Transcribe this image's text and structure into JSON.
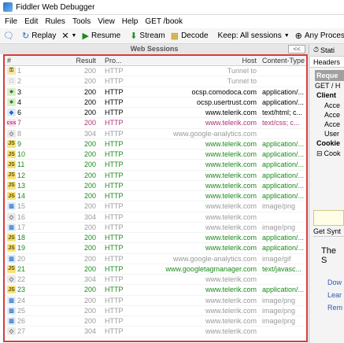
{
  "window": {
    "title": "Fiddler Web Debugger"
  },
  "menu": [
    "File",
    "Edit",
    "Rules",
    "Tools",
    "View",
    "Help",
    "GET /book"
  ],
  "toolbar": {
    "replay": "Replay",
    "resume": "Resume",
    "stream": "Stream",
    "decode": "Decode",
    "keep": "Keep: All sessions",
    "process": "Any Process"
  },
  "web_sessions": {
    "title": "Web Sessions",
    "collapse": "<<"
  },
  "columns": {
    "num": "#",
    "result": "Result",
    "protocol": "Pro...",
    "host": "Host",
    "content_type": "Content-Type"
  },
  "colors": {
    "green": "#1a8a1a",
    "gray": "#9a9a9a",
    "magenta": "#b0307a",
    "highlight": "#d63c3c"
  },
  "sessions": [
    {
      "num": "1",
      "result": "200",
      "protocol": "HTTP",
      "host": "Tunnel to",
      "content_type": "",
      "icon": "lock-icon",
      "color": "gray"
    },
    {
      "num": "2",
      "result": "200",
      "protocol": "HTTP",
      "host": "Tunnel to",
      "content_type": "",
      "icon": "doc-icon",
      "color": "gray"
    },
    {
      "num": "3",
      "result": "200",
      "protocol": "HTTP",
      "host": "ocsp.comodoca.com",
      "content_type": "application/...",
      "icon": "cert-icon",
      "color": "black"
    },
    {
      "num": "4",
      "result": "200",
      "protocol": "HTTP",
      "host": "ocsp.usertrust.com",
      "content_type": "application/...",
      "icon": "cert-icon",
      "color": "black"
    },
    {
      "num": "6",
      "result": "200",
      "protocol": "HTTP",
      "host": "www.telerik.com",
      "content_type": "text/html; c...",
      "icon": "html-icon",
      "color": "black"
    },
    {
      "num": "7",
      "result": "200",
      "protocol": "HTTP",
      "host": "www.telerik.com",
      "content_type": "text/css; c...",
      "icon": "css-icon",
      "color": "magenta"
    },
    {
      "num": "8",
      "result": "304",
      "protocol": "HTTP",
      "host": "www.google-analytics.com",
      "content_type": "",
      "icon": "cache-icon",
      "color": "gray"
    },
    {
      "num": "9",
      "result": "200",
      "protocol": "HTTP",
      "host": "www.telerik.com",
      "content_type": "application/...",
      "icon": "js-icon",
      "color": "green"
    },
    {
      "num": "10",
      "result": "200",
      "protocol": "HTTP",
      "host": "www.telerik.com",
      "content_type": "application/...",
      "icon": "js-icon",
      "color": "green"
    },
    {
      "num": "11",
      "result": "200",
      "protocol": "HTTP",
      "host": "www.telerik.com",
      "content_type": "application/...",
      "icon": "js-icon",
      "color": "green"
    },
    {
      "num": "12",
      "result": "200",
      "protocol": "HTTP",
      "host": "www.telerik.com",
      "content_type": "application/...",
      "icon": "js-icon",
      "color": "green"
    },
    {
      "num": "13",
      "result": "200",
      "protocol": "HTTP",
      "host": "www.telerik.com",
      "content_type": "application/...",
      "icon": "js-icon",
      "color": "green"
    },
    {
      "num": "14",
      "result": "200",
      "protocol": "HTTP",
      "host": "www.telerik.com",
      "content_type": "application/...",
      "icon": "js-icon",
      "color": "green"
    },
    {
      "num": "15",
      "result": "200",
      "protocol": "HTTP",
      "host": "www.telerik.com",
      "content_type": "image/png",
      "icon": "image-icon",
      "color": "gray"
    },
    {
      "num": "16",
      "result": "304",
      "protocol": "HTTP",
      "host": "www.telerik.com",
      "content_type": "",
      "icon": "cache-icon",
      "color": "gray"
    },
    {
      "num": "17",
      "result": "200",
      "protocol": "HTTP",
      "host": "www.telerik.com",
      "content_type": "image/png",
      "icon": "image-icon",
      "color": "gray"
    },
    {
      "num": "18",
      "result": "200",
      "protocol": "HTTP",
      "host": "www.telerik.com",
      "content_type": "application/...",
      "icon": "js-icon",
      "color": "green"
    },
    {
      "num": "19",
      "result": "200",
      "protocol": "HTTP",
      "host": "www.telerik.com",
      "content_type": "application/...",
      "icon": "js-icon",
      "color": "green"
    },
    {
      "num": "20",
      "result": "200",
      "protocol": "HTTP",
      "host": "www.google-analytics.com",
      "content_type": "image/gif",
      "icon": "image-icon",
      "color": "gray"
    },
    {
      "num": "21",
      "result": "200",
      "protocol": "HTTP",
      "host": "www.googletagmanager.com",
      "content_type": "text/javasc...",
      "icon": "js-icon",
      "color": "green"
    },
    {
      "num": "22",
      "result": "304",
      "protocol": "HTTP",
      "host": "www.telerik.com",
      "content_type": "",
      "icon": "cache-icon",
      "color": "gray"
    },
    {
      "num": "23",
      "result": "200",
      "protocol": "HTTP",
      "host": "www.telerik.com",
      "content_type": "application/...",
      "icon": "js-icon",
      "color": "green"
    },
    {
      "num": "24",
      "result": "200",
      "protocol": "HTTP",
      "host": "www.telerik.com",
      "content_type": "image/png",
      "icon": "image-icon",
      "color": "gray"
    },
    {
      "num": "25",
      "result": "200",
      "protocol": "HTTP",
      "host": "www.telerik.com",
      "content_type": "image/png",
      "icon": "image-icon",
      "color": "gray"
    },
    {
      "num": "26",
      "result": "200",
      "protocol": "HTTP",
      "host": "www.telerik.com",
      "content_type": "image/png",
      "icon": "image-icon",
      "color": "gray"
    },
    {
      "num": "27",
      "result": "304",
      "protocol": "HTTP",
      "host": "www.telerik.com",
      "content_type": "",
      "icon": "cache-icon",
      "color": "gray"
    }
  ],
  "inspector": {
    "tab_statistics": "Stati",
    "tab_headers": "Headers",
    "request_title": "Reque",
    "request_line": "GET / H",
    "client": "Client",
    "client_items": [
      "Acce",
      "Acce",
      "Acce",
      "User"
    ],
    "cookies": "Cookie",
    "cookie_items": [
      "Cook"
    ],
    "get_syntax": "Get Synt",
    "the": "The S",
    "links": [
      "Dow",
      "Lear",
      "Rem"
    ]
  }
}
